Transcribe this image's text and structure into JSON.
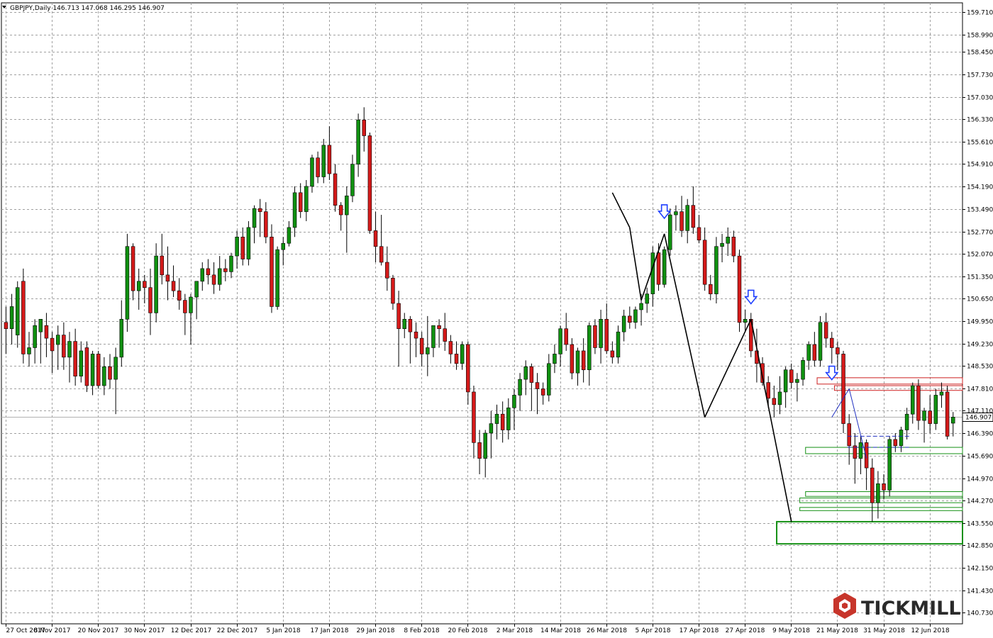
{
  "header": {
    "symbol_line": "GBPJPY,Daily  146.713 147.068 146.295 146.907"
  },
  "current_price_label": "146.907",
  "brand": {
    "name": "TICKMILL",
    "logo_icon": "tickmill-hexagon-icon"
  },
  "colors": {
    "bull": "#109010",
    "bear": "#d41a1a",
    "grid": "#a0a0a0",
    "axis": "#000000",
    "pattern_line": "#000000",
    "arrow": "#1f3fff",
    "resistance_box": "#cc2020",
    "support_box": "#159015",
    "projection": "#2030c0",
    "price_line": "#b0b0b0",
    "brand_icon": "#c7352b"
  },
  "chart_data": {
    "type": "candlestick",
    "title": "GBPJPY,Daily",
    "ohlc_readout": {
      "open": 146.713,
      "high": 147.068,
      "low": 146.295,
      "close": 146.907
    },
    "ylim": [
      140.6,
      159.6
    ],
    "y_ticks": [
      "159.710",
      "158.990",
      "158.450",
      "157.730",
      "157.030",
      "156.330",
      "155.610",
      "154.910",
      "154.190",
      "153.490",
      "152.770",
      "152.070",
      "151.350",
      "150.650",
      "149.950",
      "149.230",
      "148.530",
      "147.810",
      "147.110",
      "146.390",
      "145.690",
      "144.970",
      "144.270",
      "143.550",
      "142.850",
      "142.150",
      "141.430",
      "140.730"
    ],
    "x_labels": [
      "27 Oct 2017",
      "8 Nov 2017",
      "20 Nov 2017",
      "30 Nov 2017",
      "12 Dec 2017",
      "22 Dec 2017",
      "5 Jan 2018",
      "17 Jan 2018",
      "29 Jan 2018",
      "8 Feb 2018",
      "20 Feb 2018",
      "2 Mar 2018",
      "14 Mar 2018",
      "26 Mar 2018",
      "5 Apr 2018",
      "17 Apr 2018",
      "27 Apr 2018",
      "9 May 2018",
      "21 May 2018",
      "31 May 2018",
      "12 Jun 2018"
    ],
    "candles": [
      [
        149.9,
        150.4,
        148.9,
        149.7
      ],
      [
        149.7,
        150.8,
        149.2,
        150.4
      ],
      [
        149.5,
        151.2,
        149.1,
        151.0
      ],
      [
        151.2,
        151.6,
        148.6,
        148.9
      ],
      [
        148.9,
        149.6,
        148.5,
        149.1
      ],
      [
        149.1,
        150.0,
        148.6,
        149.8
      ],
      [
        149.6,
        150.0,
        148.6,
        150.0
      ],
      [
        149.8,
        150.2,
        148.8,
        149.4
      ],
      [
        149.4,
        149.6,
        148.3,
        149.0
      ],
      [
        149.2,
        149.8,
        148.4,
        149.5
      ],
      [
        149.5,
        149.9,
        148.4,
        148.8
      ],
      [
        148.8,
        149.6,
        148.0,
        149.3
      ],
      [
        149.3,
        149.7,
        147.9,
        148.2
      ],
      [
        148.2,
        149.3,
        148.0,
        149.0
      ],
      [
        149.1,
        149.3,
        147.7,
        147.9
      ],
      [
        147.9,
        149.0,
        147.6,
        148.9
      ],
      [
        148.9,
        149.0,
        147.8,
        147.9
      ],
      [
        147.9,
        148.8,
        147.6,
        148.5
      ],
      [
        148.5,
        148.9,
        147.8,
        148.1
      ],
      [
        148.1,
        149.1,
        147.0,
        148.8
      ],
      [
        148.8,
        150.6,
        148.5,
        150.0
      ],
      [
        150.0,
        152.7,
        149.6,
        152.3
      ],
      [
        152.3,
        152.4,
        150.6,
        150.9
      ],
      [
        150.9,
        151.6,
        150.3,
        151.2
      ],
      [
        151.2,
        151.4,
        150.5,
        151.0
      ],
      [
        151.0,
        151.6,
        149.5,
        150.2
      ],
      [
        150.2,
        152.4,
        149.9,
        152.0
      ],
      [
        152.0,
        152.7,
        151.1,
        151.4
      ],
      [
        151.4,
        152.3,
        150.6,
        151.2
      ],
      [
        151.2,
        151.7,
        150.7,
        150.9
      ],
      [
        150.9,
        151.3,
        150.3,
        150.6
      ],
      [
        150.6,
        150.8,
        149.5,
        150.2
      ],
      [
        150.2,
        150.8,
        149.2,
        150.7
      ],
      [
        150.7,
        151.2,
        150.0,
        151.2
      ],
      [
        151.2,
        151.8,
        150.9,
        151.6
      ],
      [
        151.6,
        151.9,
        151.1,
        151.4
      ],
      [
        151.4,
        151.8,
        150.8,
        151.1
      ],
      [
        151.1,
        152.0,
        150.9,
        151.6
      ],
      [
        151.6,
        151.9,
        151.2,
        151.5
      ],
      [
        151.5,
        152.1,
        151.3,
        152.0
      ],
      [
        152.0,
        152.8,
        151.6,
        152.6
      ],
      [
        152.6,
        152.9,
        151.7,
        151.9
      ],
      [
        151.9,
        153.1,
        151.7,
        152.9
      ],
      [
        152.9,
        153.6,
        152.4,
        153.5
      ],
      [
        153.5,
        153.8,
        152.6,
        153.4
      ],
      [
        153.4,
        153.7,
        152.4,
        152.6
      ],
      [
        152.6,
        153.0,
        150.2,
        150.4
      ],
      [
        150.4,
        152.3,
        150.3,
        152.2
      ],
      [
        152.2,
        152.6,
        151.7,
        152.4
      ],
      [
        152.4,
        153.1,
        152.3,
        152.9
      ],
      [
        152.9,
        154.2,
        152.6,
        154.0
      ],
      [
        154.0,
        154.3,
        153.2,
        153.4
      ],
      [
        153.4,
        154.4,
        153.1,
        154.2
      ],
      [
        154.2,
        155.2,
        154.0,
        155.1
      ],
      [
        155.1,
        155.3,
        154.3,
        154.5
      ],
      [
        154.5,
        155.7,
        154.3,
        155.5
      ],
      [
        155.5,
        156.1,
        154.4,
        154.6
      ],
      [
        154.6,
        154.9,
        153.4,
        153.6
      ],
      [
        153.6,
        153.7,
        152.8,
        153.3
      ],
      [
        153.3,
        154.2,
        152.1,
        153.9
      ],
      [
        153.9,
        155.2,
        153.7,
        154.9
      ],
      [
        154.9,
        156.5,
        154.5,
        156.3
      ],
      [
        156.3,
        156.7,
        155.3,
        155.8
      ],
      [
        155.8,
        155.9,
        152.7,
        152.8
      ],
      [
        152.8,
        153.4,
        151.8,
        152.3
      ],
      [
        152.3,
        153.3,
        151.7,
        151.8
      ],
      [
        151.8,
        152.3,
        150.9,
        151.3
      ],
      [
        151.3,
        151.4,
        150.3,
        150.5
      ],
      [
        150.5,
        150.9,
        148.5,
        149.7
      ],
      [
        149.7,
        150.2,
        149.4,
        150.0
      ],
      [
        150.0,
        150.1,
        148.6,
        149.6
      ],
      [
        149.6,
        149.9,
        148.8,
        149.4
      ],
      [
        149.4,
        149.6,
        148.5,
        148.9
      ],
      [
        148.9,
        150.1,
        148.2,
        149.1
      ],
      [
        149.1,
        149.8,
        148.8,
        149.8
      ],
      [
        149.8,
        150.0,
        149.1,
        149.7
      ],
      [
        149.7,
        150.2,
        149.0,
        149.3
      ],
      [
        149.3,
        149.5,
        148.6,
        148.9
      ],
      [
        148.9,
        149.3,
        148.4,
        148.6
      ],
      [
        148.6,
        149.3,
        148.4,
        149.2
      ],
      [
        149.2,
        149.3,
        147.3,
        147.7
      ],
      [
        147.7,
        147.9,
        145.6,
        146.1
      ],
      [
        146.1,
        146.5,
        145.1,
        145.6
      ],
      [
        145.6,
        146.5,
        145.0,
        146.4
      ],
      [
        146.4,
        147.1,
        145.6,
        146.7
      ],
      [
        146.7,
        147.3,
        146.2,
        147.0
      ],
      [
        147.0,
        147.4,
        146.1,
        146.5
      ],
      [
        146.5,
        147.5,
        146.2,
        147.2
      ],
      [
        147.2,
        147.8,
        146.5,
        147.6
      ],
      [
        147.6,
        148.3,
        147.1,
        148.1
      ],
      [
        148.1,
        148.7,
        147.6,
        148.5
      ],
      [
        148.5,
        148.6,
        147.1,
        148.0
      ],
      [
        148.0,
        148.3,
        147.0,
        147.8
      ],
      [
        147.8,
        148.0,
        147.3,
        147.6
      ],
      [
        147.6,
        148.9,
        147.4,
        148.6
      ],
      [
        148.6,
        149.2,
        148.3,
        148.9
      ],
      [
        148.9,
        149.8,
        148.5,
        149.7
      ],
      [
        149.7,
        150.2,
        149.0,
        149.2
      ],
      [
        149.2,
        149.4,
        148.1,
        148.3
      ],
      [
        148.3,
        149.1,
        147.9,
        149.0
      ],
      [
        149.0,
        149.4,
        148.0,
        148.4
      ],
      [
        148.4,
        149.9,
        147.9,
        149.8
      ],
      [
        149.8,
        150.0,
        148.9,
        149.1
      ],
      [
        149.1,
        150.3,
        148.6,
        150.0
      ],
      [
        150.0,
        150.5,
        148.9,
        149.0
      ],
      [
        149.0,
        149.3,
        148.6,
        148.8
      ],
      [
        148.8,
        149.8,
        148.6,
        149.6
      ],
      [
        149.6,
        150.3,
        149.3,
        150.1
      ],
      [
        150.1,
        150.4,
        149.7,
        149.9
      ],
      [
        149.9,
        150.4,
        149.7,
        150.3
      ],
      [
        150.3,
        150.8,
        149.8,
        150.5
      ],
      [
        150.5,
        151.0,
        150.2,
        150.8
      ],
      [
        150.8,
        152.3,
        150.4,
        152.1
      ],
      [
        152.1,
        152.4,
        150.9,
        151.1
      ],
      [
        151.1,
        152.3,
        151.0,
        152.2
      ],
      [
        152.2,
        153.5,
        152.0,
        153.3
      ],
      [
        153.3,
        153.6,
        152.8,
        153.4
      ],
      [
        153.4,
        153.9,
        152.6,
        152.8
      ],
      [
        152.8,
        153.8,
        152.4,
        153.6
      ],
      [
        153.6,
        154.2,
        152.7,
        152.9
      ],
      [
        152.9,
        153.3,
        152.4,
        152.5
      ],
      [
        152.5,
        152.9,
        150.9,
        151.1
      ],
      [
        151.1,
        151.4,
        150.6,
        150.8
      ],
      [
        150.8,
        152.6,
        150.5,
        152.3
      ],
      [
        152.3,
        152.7,
        151.8,
        152.4
      ],
      [
        152.4,
        152.9,
        152.0,
        152.6
      ],
      [
        152.6,
        152.8,
        151.8,
        152.0
      ],
      [
        152.0,
        152.2,
        149.6,
        149.9
      ],
      [
        149.9,
        150.3,
        149.6,
        150.0
      ],
      [
        150.0,
        150.2,
        148.8,
        149.0
      ],
      [
        149.0,
        149.7,
        148.0,
        148.6
      ],
      [
        148.6,
        148.8,
        147.9,
        148.0
      ],
      [
        148.0,
        148.2,
        147.2,
        147.5
      ],
      [
        147.5,
        147.9,
        146.9,
        147.3
      ],
      [
        147.3,
        148.2,
        147.0,
        147.7
      ],
      [
        147.7,
        148.5,
        147.2,
        148.4
      ],
      [
        148.4,
        148.6,
        147.8,
        148.0
      ],
      [
        148.0,
        148.3,
        147.4,
        148.1
      ],
      [
        148.1,
        148.8,
        147.9,
        148.7
      ],
      [
        148.7,
        149.3,
        148.4,
        149.2
      ],
      [
        149.2,
        149.6,
        148.5,
        148.7
      ],
      [
        148.7,
        150.1,
        148.5,
        149.9
      ],
      [
        149.9,
        150.2,
        149.1,
        149.4
      ],
      [
        149.4,
        149.6,
        148.6,
        149.1
      ],
      [
        149.1,
        149.3,
        148.4,
        148.9
      ],
      [
        148.9,
        149.0,
        146.4,
        146.7
      ],
      [
        146.7,
        147.0,
        145.4,
        146.0
      ],
      [
        146.0,
        146.4,
        144.8,
        145.6
      ],
      [
        145.6,
        146.3,
        145.1,
        146.1
      ],
      [
        146.1,
        146.2,
        144.6,
        145.3
      ],
      [
        145.3,
        145.6,
        143.6,
        144.2
      ],
      [
        144.2,
        145.2,
        143.7,
        144.8
      ],
      [
        144.8,
        145.1,
        144.3,
        144.6
      ],
      [
        144.6,
        146.3,
        144.4,
        146.2
      ],
      [
        146.2,
        146.4,
        145.8,
        146.0
      ],
      [
        146.0,
        146.6,
        145.8,
        146.5
      ],
      [
        146.5,
        147.2,
        146.2,
        147.0
      ],
      [
        147.0,
        148.0,
        146.7,
        147.9
      ],
      [
        147.9,
        148.1,
        146.5,
        146.8
      ],
      [
        146.8,
        147.2,
        146.1,
        147.1
      ],
      [
        147.1,
        147.6,
        146.4,
        146.7
      ],
      [
        146.7,
        147.8,
        146.5,
        147.6
      ],
      [
        147.6,
        148.0,
        147.2,
        147.7
      ],
      [
        147.7,
        147.9,
        146.2,
        146.3
      ],
      [
        146.713,
        147.068,
        146.295,
        146.907
      ]
    ],
    "annotations": {
      "zigzag_lines": [
        [
          [
            105,
            154.0
          ],
          [
            108,
            152.9
          ]
        ],
        [
          [
            108,
            152.9
          ],
          [
            110,
            150.6
          ]
        ],
        [
          [
            110,
            150.6
          ],
          [
            114,
            152.7
          ]
        ],
        [
          [
            114,
            152.7
          ],
          [
            121,
            146.9
          ]
        ],
        [
          [
            121,
            146.9
          ],
          [
            129,
            150.0
          ]
        ],
        [
          [
            129,
            150.0
          ],
          [
            136,
            143.6
          ]
        ]
      ],
      "arrows": [
        [
          114,
          153.1
        ],
        [
          129,
          150.4
        ],
        [
          143,
          148.0
        ]
      ],
      "resistance_boxes": [
        [
          141,
          148.15,
          156,
          147.95
        ],
        [
          144,
          147.9,
          156,
          147.75
        ]
      ],
      "support_boxes": [
        [
          139,
          145.95,
          156,
          145.75
        ],
        [
          139,
          144.55,
          156,
          144.4
        ],
        [
          138,
          144.35,
          156,
          144.2
        ],
        [
          138,
          144.05,
          156,
          143.95
        ],
        [
          134,
          143.6,
          156,
          142.9
        ]
      ],
      "projection_lines": [
        [
          [
            143,
            146.9
          ],
          [
            146,
            147.8
          ]
        ],
        [
          [
            146,
            147.8
          ],
          [
            149,
            145.6
          ]
        ]
      ],
      "projection_dashed": [
        [
          146,
          146.3,
          157,
          146.3
        ],
        [
          146,
          145.95,
          157,
          145.95
        ]
      ]
    }
  }
}
